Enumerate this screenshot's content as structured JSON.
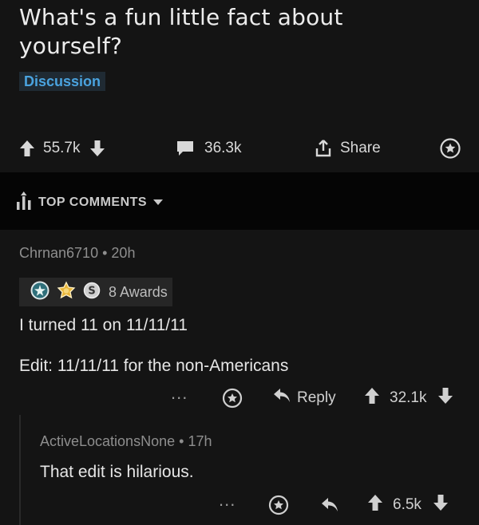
{
  "post": {
    "title": "What's a fun little fact about yourself?",
    "flair": "Discussion",
    "upvotes": "55.7k",
    "comments_count": "36.3k",
    "share_label": "Share"
  },
  "sort": {
    "label": "TOP COMMENTS"
  },
  "comment": {
    "author": "Chrnan6710",
    "age": "20h",
    "awards_label": "8 Awards",
    "lines": [
      "I turned 11 on 11/11/11",
      "Edit: 11/11/11 for the non-Americans"
    ],
    "more": "...",
    "reply_label": "Reply",
    "score": "32.1k"
  },
  "reply": {
    "author": "ActiveLocationsNone",
    "age": "17h",
    "text": "That edit is hilarious.",
    "more": "...",
    "score": "6.5k"
  },
  "colors": {
    "background": "#141414",
    "band": "#050505",
    "flair_text": "#4aa3df",
    "text": "#e6e6e6",
    "muted": "#8e8e8e"
  },
  "icons": [
    "upvote-icon",
    "downvote-icon",
    "comment-icon",
    "share-icon",
    "award-icon",
    "sort-icon",
    "caret-down-icon",
    "reply-icon",
    "more-icon"
  ]
}
